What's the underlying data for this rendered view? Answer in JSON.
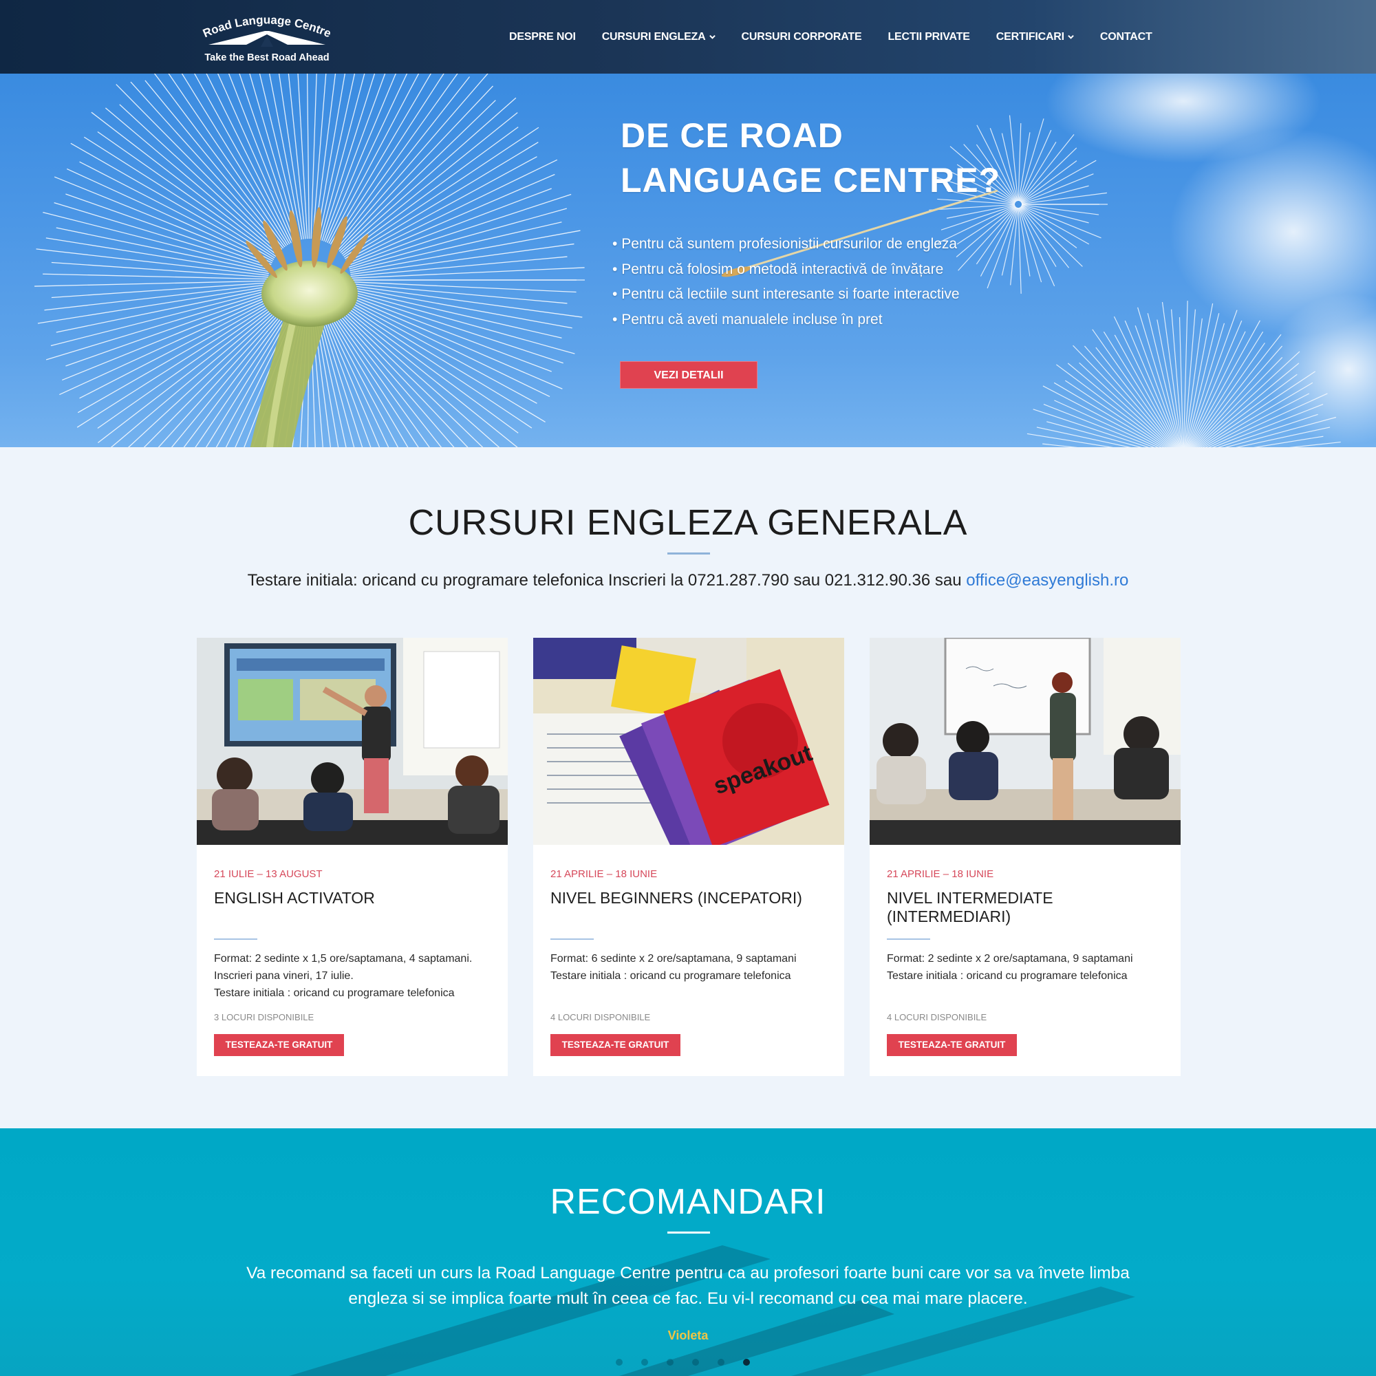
{
  "header": {
    "logo": {
      "text_top": "Road Language Centre",
      "tagline": "Take the Best Road Ahead"
    },
    "nav": [
      {
        "label": "DESPRE NOI",
        "has_dropdown": false
      },
      {
        "label": "CURSURI ENGLEZA",
        "has_dropdown": true
      },
      {
        "label": "CURSURI CORPORATE",
        "has_dropdown": false
      },
      {
        "label": "LECTII PRIVATE",
        "has_dropdown": false
      },
      {
        "label": "CERTIFICARI",
        "has_dropdown": true
      },
      {
        "label": "CONTACT",
        "has_dropdown": false
      }
    ]
  },
  "hero": {
    "title_line1": "DE CE ROAD",
    "title_line2": "LANGUAGE CENTRE?",
    "bullets": [
      "Pentru că suntem profesionistii cursurilor de engleza",
      "Pentru că folosim o metodă interactivă de învățare",
      "Pentru că lectiile sunt interesante si foarte interactive",
      "Pentru că aveti manualele incluse în pret"
    ],
    "button_label": "VEZI DETALII"
  },
  "courses": {
    "title": "CURSURI ENGLEZA GENERALA",
    "contact_text": "Testare initiala: oricand cu programare telefonica Inscrieri la 0721.287.790 sau 021.312.90.36 sau",
    "contact_email": "office@easyenglish.ro",
    "cards": [
      {
        "date": "21 IULIE – 13 AUGUST",
        "title": "ENGLISH ACTIVATOR",
        "desc": [
          "Format: 2 sedinte x 1,5 ore/saptamana, 4 saptamani.",
          "Inscrieri pana vineri, 17 iulie.",
          "Testare initiala : oricand cu programare telefonica"
        ],
        "seats": "3 LOCURI DISPONIBILE",
        "button": "TESTEAZA-TE GRATUIT"
      },
      {
        "date": "21 APRILIE – 18 IUNIE",
        "title": "NIVEL BEGINNERS (INCEPATORI)",
        "desc": [
          "Format: 6 sedinte x 2 ore/saptamana, 9 saptamani",
          "Testare initiala : oricand cu programare telefonica",
          ""
        ],
        "seats": "4 LOCURI DISPONIBILE",
        "button": "TESTEAZA-TE GRATUIT",
        "book_text": "speakout"
      },
      {
        "date": "21 APRILIE – 18 IUNIE",
        "title": "NIVEL INTERMEDIATE (INTERMEDIARI)",
        "desc": [
          "Format: 2 sedinte x 2 ore/saptamana, 9 saptamani",
          "Testare initiala : oricand cu programare telefonica",
          ""
        ],
        "seats": "4 LOCURI DISPONIBILE",
        "button": "TESTEAZA-TE GRATUIT"
      }
    ]
  },
  "recommendations": {
    "title": "RECOMANDARI",
    "quote_line1": "Va recomand sa faceti un curs la Road Language Centre pentru ca au profesori foarte buni care vor sa va învete limba",
    "quote_line2": "engleza si se implica foarte mult în ceea ce fac. Eu vi-l recomand cu cea mai mare placere.",
    "author": "Violeta",
    "slides_count": 6,
    "active_slide": 6
  },
  "colors": {
    "accent_red": "#e04250",
    "header_navy": "#1b3556",
    "reco_teal": "#03abc9",
    "author_gold": "#f0c544",
    "link_blue": "#2f7ad6"
  }
}
